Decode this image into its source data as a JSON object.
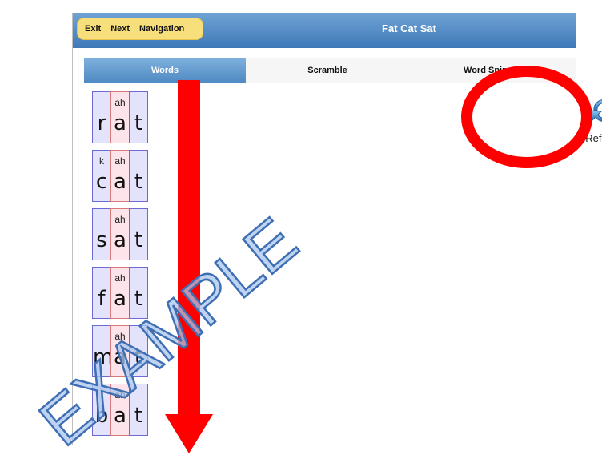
{
  "header": {
    "nav": [
      "Exit",
      "Next",
      "Navigation"
    ],
    "title": "Fat Cat Sat"
  },
  "tabs": [
    "Words",
    "Scramble",
    "Word Spinner"
  ],
  "words": [
    {
      "letters": [
        {
          "ch": "r",
          "sound": ""
        },
        {
          "ch": "a",
          "sound": "ah",
          "vowel": true
        },
        {
          "ch": "t",
          "sound": ""
        }
      ]
    },
    {
      "letters": [
        {
          "ch": "c",
          "sound": "k"
        },
        {
          "ch": "a",
          "sound": "ah",
          "vowel": true
        },
        {
          "ch": "t",
          "sound": ""
        }
      ]
    },
    {
      "letters": [
        {
          "ch": "s",
          "sound": ""
        },
        {
          "ch": "a",
          "sound": "ah",
          "vowel": true
        },
        {
          "ch": "t",
          "sound": ""
        }
      ]
    },
    {
      "letters": [
        {
          "ch": "f",
          "sound": ""
        },
        {
          "ch": "a",
          "sound": "ah",
          "vowel": true
        },
        {
          "ch": "t",
          "sound": ""
        }
      ]
    },
    {
      "letters": [
        {
          "ch": "m",
          "sound": ""
        },
        {
          "ch": "a",
          "sound": "ah",
          "vowel": true
        },
        {
          "ch": "t",
          "sound": ""
        }
      ]
    },
    {
      "letters": [
        {
          "ch": "b",
          "sound": ""
        },
        {
          "ch": "a",
          "sound": "ah",
          "vowel": true
        },
        {
          "ch": "t",
          "sound": ""
        }
      ]
    }
  ],
  "refresh": {
    "label": "Refresh",
    "icon": "refresh-icon"
  },
  "watermark": "EXAMPLE",
  "colors": {
    "arrow": "#ff0000",
    "circle": "#ff0000",
    "accent": "#4e89c2",
    "navPill": "#f7df7b"
  }
}
